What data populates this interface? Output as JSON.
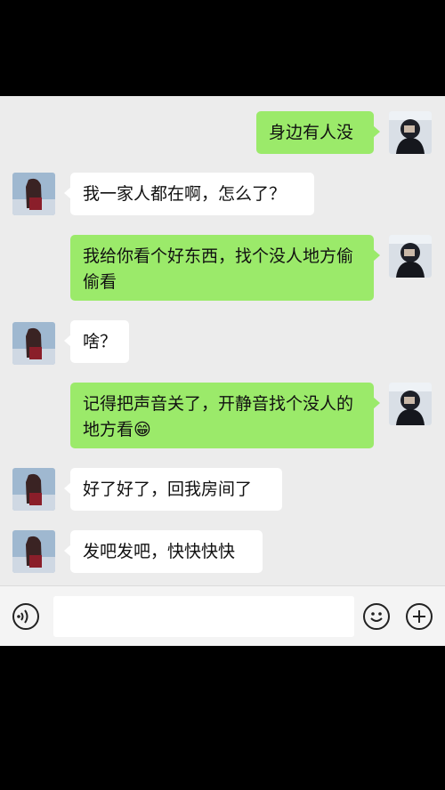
{
  "messages": [
    {
      "side": "out",
      "text": "身边有人没"
    },
    {
      "side": "in",
      "text": "我一家人都在啊，怎么了？"
    },
    {
      "side": "out",
      "text": "我给你看个好东西，找个没人地方偷偷看"
    },
    {
      "side": "in",
      "text": "啥？"
    },
    {
      "side": "out",
      "text": "记得把声音关了，开静音找个没人的地方看😁"
    },
    {
      "side": "in",
      "text": "好了好了，回我房间了"
    },
    {
      "side": "in",
      "text": "发吧发吧，快快快快"
    }
  ],
  "input": {
    "value": "",
    "placeholder": ""
  },
  "icons": {
    "voice": "voice-icon",
    "emoji": "emoji-icon",
    "plus": "plus-icon"
  },
  "colors": {
    "out_bubble": "#9bea6a",
    "in_bubble": "#ffffff",
    "chat_bg": "#ececec"
  }
}
